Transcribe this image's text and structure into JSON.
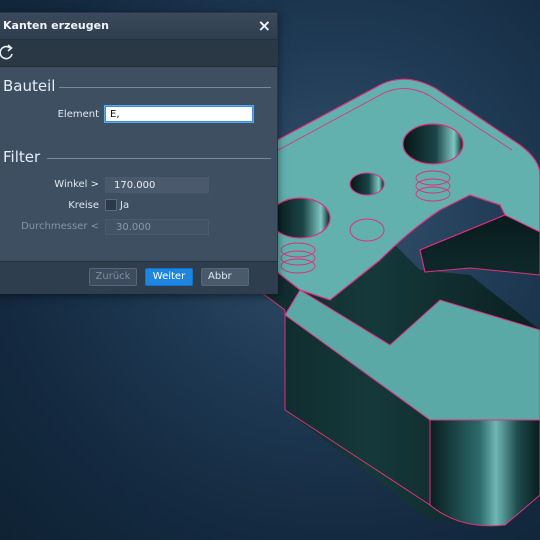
{
  "dialog": {
    "title": "Kanten erzeugen",
    "close_icon": "close-icon",
    "tool_icon": "refresh-icon"
  },
  "sections": {
    "bauteil": {
      "title": "Bauteil",
      "element_label": "Element",
      "element_value": "E,"
    },
    "filter": {
      "title": "Filter",
      "winkel_label": "Winkel >",
      "winkel_value": "170.000",
      "kreise_label": "Kreise",
      "kreise_checkbox_label": "Ja",
      "kreise_checked": false,
      "durchmesser_label": "Durchmesser <",
      "durchmesser_value": "30.000"
    }
  },
  "buttons": {
    "back": "Zurück",
    "next": "Weiter",
    "cancel": "Abbr"
  },
  "colors": {
    "model_face": "#60b0b0",
    "model_edge": "#e0307a",
    "primary_button": "#1f86e0",
    "dialog_bg": "#3e4f62"
  }
}
